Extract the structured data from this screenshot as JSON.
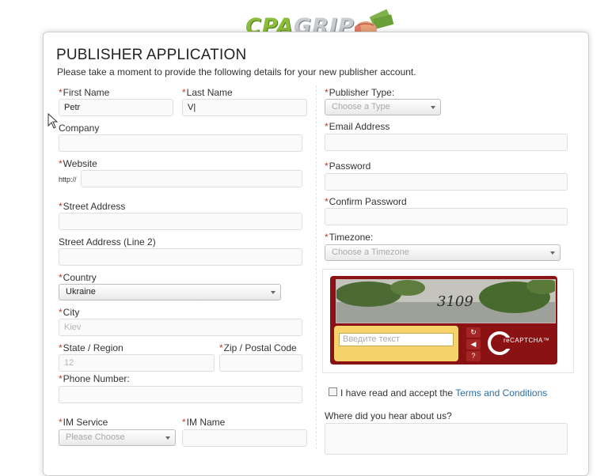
{
  "logo": {
    "part1": "CPA",
    "part2": "GRIP"
  },
  "form": {
    "title": "PUBLISHER APPLICATION",
    "subtitle": "Please take a moment to provide the following details for your new publisher account.",
    "required_mark": "*",
    "first_name": {
      "label": "First Name",
      "value": "Petr"
    },
    "last_name": {
      "label": "Last Name",
      "value": "V|"
    },
    "company": {
      "label": "Company",
      "value": ""
    },
    "website": {
      "label": "Website",
      "prefix": "http://",
      "value": ""
    },
    "street_address": {
      "label": "Street Address",
      "value": ""
    },
    "street_address_2": {
      "label": "Street Address (Line 2)",
      "value": ""
    },
    "country": {
      "label": "Country",
      "value": "Ukraine"
    },
    "city": {
      "label": "City",
      "value": "Kiev"
    },
    "state": {
      "label": "State / Region",
      "value": "12"
    },
    "zip": {
      "label": "Zip / Postal Code",
      "value": ""
    },
    "phone": {
      "label": "Phone Number:",
      "value": ""
    },
    "im_service": {
      "label": "IM Service",
      "value": "Please Choose"
    },
    "im_name": {
      "label": "IM Name",
      "value": ""
    },
    "publisher_type": {
      "label": "Publisher Type:",
      "value": "Choose a Type"
    },
    "email": {
      "label": "Email Address",
      "value": ""
    },
    "password": {
      "label": "Password",
      "value": ""
    },
    "confirm_password": {
      "label": "Confirm Password",
      "value": ""
    },
    "timezone": {
      "label": "Timezone:",
      "value": "Choose a Timezone"
    },
    "captcha": {
      "challenge_word": "3109",
      "input_placeholder": "Введите текст",
      "brand": "reCAPTCHA™"
    },
    "terms": {
      "prefix": "I have read and accept the ",
      "link": "Terms and Conditions"
    },
    "referral": {
      "label": "Where did you hear about us?",
      "value": ""
    }
  },
  "colors": {
    "required": "#c0392b",
    "link": "#2c6ea4",
    "captcha_red": "#8b1212",
    "captcha_yellow": "#f7d36c",
    "logo_green": "#8bbd3c"
  }
}
